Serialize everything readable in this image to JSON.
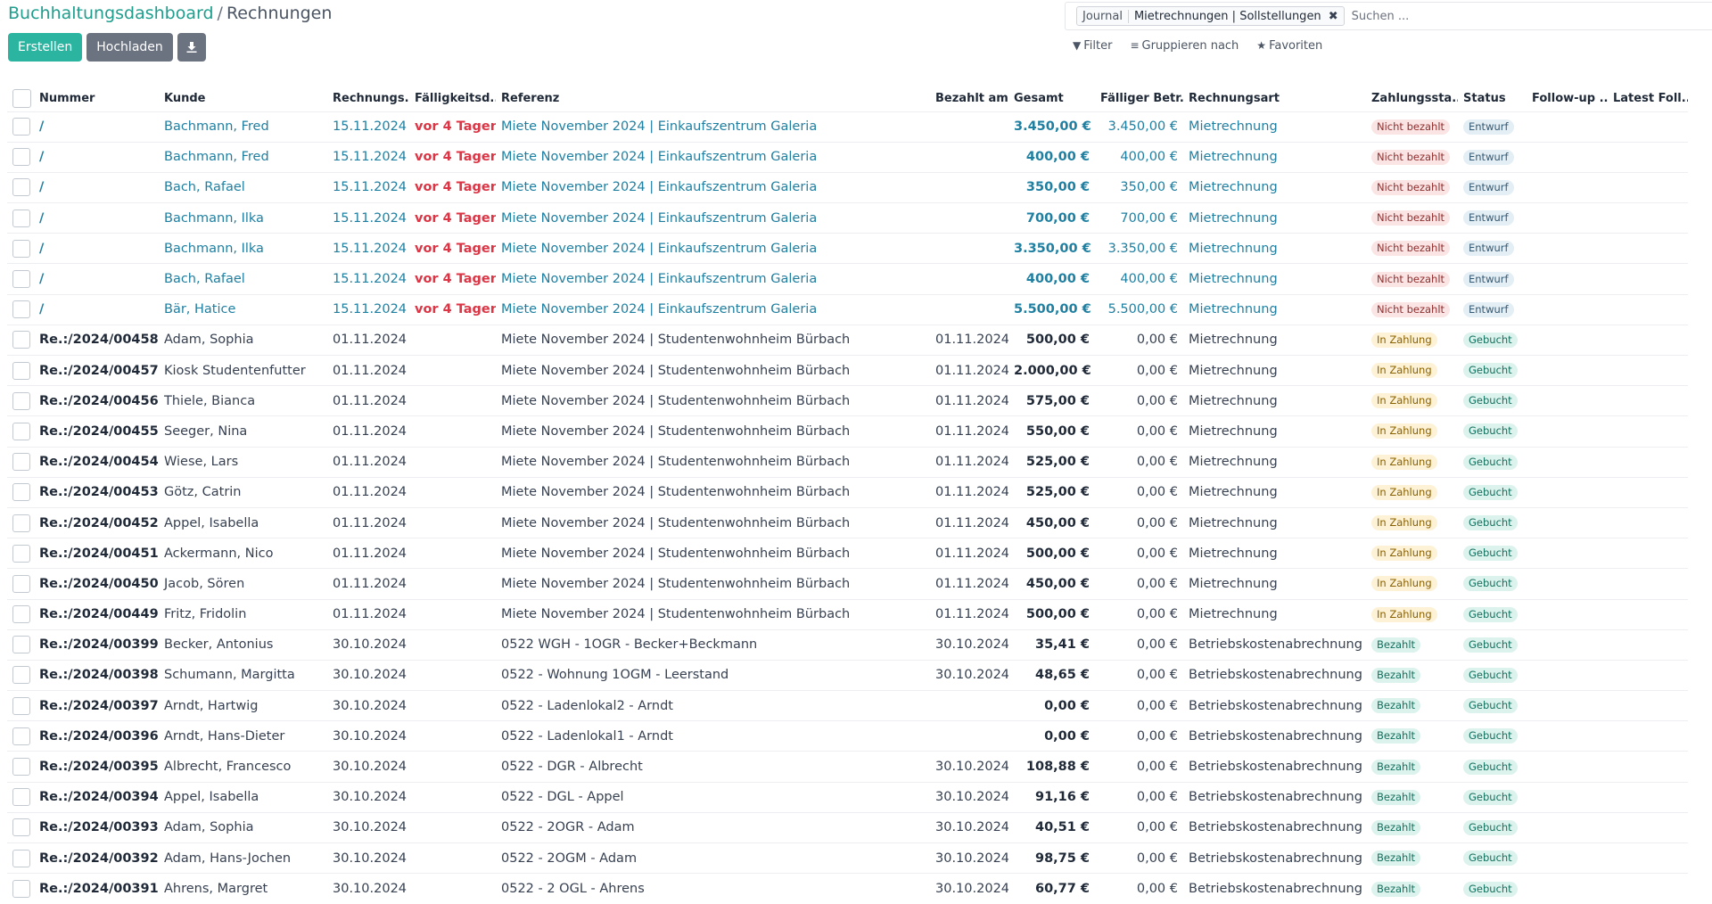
{
  "breadcrumb": {
    "parent": "Buchhaltungsdashboard",
    "separator": "/",
    "current": "Rechnungen"
  },
  "toolbar": {
    "create_label": "Erstellen",
    "upload_label": "Hochladen",
    "download_icon": "download-icon"
  },
  "search": {
    "facet_label": "Journal",
    "facet_value": "Mietrechnungen | Sollstellungen",
    "placeholder": "Suchen ..."
  },
  "filters": {
    "filter_label": "Filter",
    "group_label": "Gruppieren nach",
    "favorites_label": "Favoriten"
  },
  "colors": {
    "primary": "#2bb4a0",
    "link": "#1f7fa1",
    "danger": "#dc3545"
  },
  "columns": [
    "Nummer",
    "Kunde",
    "Rechnungs...",
    "Fälligkeitsd...",
    "Referenz",
    "Bezahlt am",
    "Gesamt",
    "Fälliger Betr...",
    "Rechnungsart",
    "Zahlungssta...",
    "Status",
    "Follow-up ...",
    "Latest Foll..."
  ],
  "rows": [
    {
      "number": "/",
      "customer": "Bachmann, Fred",
      "invoice_date": "15.11.2024",
      "due": "vor 4 Tagen",
      "reference": "Miete November 2024 | Einkaufszentrum Galeria",
      "paid_on": "",
      "total": "3.450,00 €",
      "due_amount": "3.450,00 €",
      "type": "Mietrechnung",
      "payment_status": "Nicht bezahlt",
      "status": "Entwurf",
      "draft": true
    },
    {
      "number": "/",
      "customer": "Bachmann, Fred",
      "invoice_date": "15.11.2024",
      "due": "vor 4 Tagen",
      "reference": "Miete November 2024 | Einkaufszentrum Galeria",
      "paid_on": "",
      "total": "400,00 €",
      "due_amount": "400,00 €",
      "type": "Mietrechnung",
      "payment_status": "Nicht bezahlt",
      "status": "Entwurf",
      "draft": true
    },
    {
      "number": "/",
      "customer": "Bach, Rafael",
      "invoice_date": "15.11.2024",
      "due": "vor 4 Tagen",
      "reference": "Miete November 2024 | Einkaufszentrum Galeria",
      "paid_on": "",
      "total": "350,00 €",
      "due_amount": "350,00 €",
      "type": "Mietrechnung",
      "payment_status": "Nicht bezahlt",
      "status": "Entwurf",
      "draft": true
    },
    {
      "number": "/",
      "customer": "Bachmann, Ilka",
      "invoice_date": "15.11.2024",
      "due": "vor 4 Tagen",
      "reference": "Miete November 2024 | Einkaufszentrum Galeria",
      "paid_on": "",
      "total": "700,00 €",
      "due_amount": "700,00 €",
      "type": "Mietrechnung",
      "payment_status": "Nicht bezahlt",
      "status": "Entwurf",
      "draft": true
    },
    {
      "number": "/",
      "customer": "Bachmann, Ilka",
      "invoice_date": "15.11.2024",
      "due": "vor 4 Tagen",
      "reference": "Miete November 2024 | Einkaufszentrum Galeria",
      "paid_on": "",
      "total": "3.350,00 €",
      "due_amount": "3.350,00 €",
      "type": "Mietrechnung",
      "payment_status": "Nicht bezahlt",
      "status": "Entwurf",
      "draft": true
    },
    {
      "number": "/",
      "customer": "Bach, Rafael",
      "invoice_date": "15.11.2024",
      "due": "vor 4 Tagen",
      "reference": "Miete November 2024 | Einkaufszentrum Galeria",
      "paid_on": "",
      "total": "400,00 €",
      "due_amount": "400,00 €",
      "type": "Mietrechnung",
      "payment_status": "Nicht bezahlt",
      "status": "Entwurf",
      "draft": true
    },
    {
      "number": "/",
      "customer": "Bär, Hatice",
      "invoice_date": "15.11.2024",
      "due": "vor 4 Tagen",
      "reference": "Miete November 2024 | Einkaufszentrum Galeria",
      "paid_on": "",
      "total": "5.500,00 €",
      "due_amount": "5.500,00 €",
      "type": "Mietrechnung",
      "payment_status": "Nicht bezahlt",
      "status": "Entwurf",
      "draft": true
    },
    {
      "number": "Re.:/2024/00458",
      "customer": "Adam, Sophia",
      "invoice_date": "01.11.2024",
      "due": "",
      "reference": "Miete November 2024 | Studentenwohnheim Bürbach",
      "paid_on": "01.11.2024",
      "total": "500,00 €",
      "due_amount": "0,00 €",
      "type": "Mietrechnung",
      "payment_status": "In Zahlung",
      "status": "Gebucht",
      "draft": false
    },
    {
      "number": "Re.:/2024/00457",
      "customer": "Kiosk Studentenfutter",
      "invoice_date": "01.11.2024",
      "due": "",
      "reference": "Miete November 2024 | Studentenwohnheim Bürbach",
      "paid_on": "01.11.2024",
      "total": "2.000,00 €",
      "due_amount": "0,00 €",
      "type": "Mietrechnung",
      "payment_status": "In Zahlung",
      "status": "Gebucht",
      "draft": false
    },
    {
      "number": "Re.:/2024/00456",
      "customer": "Thiele, Bianca",
      "invoice_date": "01.11.2024",
      "due": "",
      "reference": "Miete November 2024 | Studentenwohnheim Bürbach",
      "paid_on": "01.11.2024",
      "total": "575,00 €",
      "due_amount": "0,00 €",
      "type": "Mietrechnung",
      "payment_status": "In Zahlung",
      "status": "Gebucht",
      "draft": false
    },
    {
      "number": "Re.:/2024/00455",
      "customer": "Seeger, Nina",
      "invoice_date": "01.11.2024",
      "due": "",
      "reference": "Miete November 2024 | Studentenwohnheim Bürbach",
      "paid_on": "01.11.2024",
      "total": "550,00 €",
      "due_amount": "0,00 €",
      "type": "Mietrechnung",
      "payment_status": "In Zahlung",
      "status": "Gebucht",
      "draft": false
    },
    {
      "number": "Re.:/2024/00454",
      "customer": "Wiese, Lars",
      "invoice_date": "01.11.2024",
      "due": "",
      "reference": "Miete November 2024 | Studentenwohnheim Bürbach",
      "paid_on": "01.11.2024",
      "total": "525,00 €",
      "due_amount": "0,00 €",
      "type": "Mietrechnung",
      "payment_status": "In Zahlung",
      "status": "Gebucht",
      "draft": false
    },
    {
      "number": "Re.:/2024/00453",
      "customer": "Götz, Catrin",
      "invoice_date": "01.11.2024",
      "due": "",
      "reference": "Miete November 2024 | Studentenwohnheim Bürbach",
      "paid_on": "01.11.2024",
      "total": "525,00 €",
      "due_amount": "0,00 €",
      "type": "Mietrechnung",
      "payment_status": "In Zahlung",
      "status": "Gebucht",
      "draft": false
    },
    {
      "number": "Re.:/2024/00452",
      "customer": "Appel, Isabella",
      "invoice_date": "01.11.2024",
      "due": "",
      "reference": "Miete November 2024 | Studentenwohnheim Bürbach",
      "paid_on": "01.11.2024",
      "total": "450,00 €",
      "due_amount": "0,00 €",
      "type": "Mietrechnung",
      "payment_status": "In Zahlung",
      "status": "Gebucht",
      "draft": false
    },
    {
      "number": "Re.:/2024/00451",
      "customer": "Ackermann, Nico",
      "invoice_date": "01.11.2024",
      "due": "",
      "reference": "Miete November 2024 | Studentenwohnheim Bürbach",
      "paid_on": "01.11.2024",
      "total": "500,00 €",
      "due_amount": "0,00 €",
      "type": "Mietrechnung",
      "payment_status": "In Zahlung",
      "status": "Gebucht",
      "draft": false
    },
    {
      "number": "Re.:/2024/00450",
      "customer": "Jacob, Sören",
      "invoice_date": "01.11.2024",
      "due": "",
      "reference": "Miete November 2024 | Studentenwohnheim Bürbach",
      "paid_on": "01.11.2024",
      "total": "450,00 €",
      "due_amount": "0,00 €",
      "type": "Mietrechnung",
      "payment_status": "In Zahlung",
      "status": "Gebucht",
      "draft": false
    },
    {
      "number": "Re.:/2024/00449",
      "customer": "Fritz, Fridolin",
      "invoice_date": "01.11.2024",
      "due": "",
      "reference": "Miete November 2024 | Studentenwohnheim Bürbach",
      "paid_on": "01.11.2024",
      "total": "500,00 €",
      "due_amount": "0,00 €",
      "type": "Mietrechnung",
      "payment_status": "In Zahlung",
      "status": "Gebucht",
      "draft": false
    },
    {
      "number": "Re.:/2024/00399",
      "customer": "Becker, Antonius",
      "invoice_date": "30.10.2024",
      "due": "",
      "reference": "0522 WGH - 1OGR - Becker+Beckmann",
      "paid_on": "30.10.2024",
      "total": "35,41 €",
      "due_amount": "0,00 €",
      "type": "Betriebskostenabrechnung",
      "payment_status": "Bezahlt",
      "status": "Gebucht",
      "draft": false
    },
    {
      "number": "Re.:/2024/00398",
      "customer": "Schumann, Margitta",
      "invoice_date": "30.10.2024",
      "due": "",
      "reference": "0522 - Wohnung 1OGM - Leerstand",
      "paid_on": "30.10.2024",
      "total": "48,65 €",
      "due_amount": "0,00 €",
      "type": "Betriebskostenabrechnung",
      "payment_status": "Bezahlt",
      "status": "Gebucht",
      "draft": false
    },
    {
      "number": "Re.:/2024/00397",
      "customer": "Arndt, Hartwig",
      "invoice_date": "30.10.2024",
      "due": "",
      "reference": "0522 - Ladenlokal2 - Arndt",
      "paid_on": "",
      "total": "0,00 €",
      "due_amount": "0,00 €",
      "type": "Betriebskostenabrechnung",
      "payment_status": "Bezahlt",
      "status": "Gebucht",
      "draft": false
    },
    {
      "number": "Re.:/2024/00396",
      "customer": "Arndt, Hans-Dieter",
      "invoice_date": "30.10.2024",
      "due": "",
      "reference": "0522 - Ladenlokal1 - Arndt",
      "paid_on": "",
      "total": "0,00 €",
      "due_amount": "0,00 €",
      "type": "Betriebskostenabrechnung",
      "payment_status": "Bezahlt",
      "status": "Gebucht",
      "draft": false
    },
    {
      "number": "Re.:/2024/00395",
      "customer": "Albrecht, Francesco",
      "invoice_date": "30.10.2024",
      "due": "",
      "reference": "0522 - DGR - Albrecht",
      "paid_on": "30.10.2024",
      "total": "108,88 €",
      "due_amount": "0,00 €",
      "type": "Betriebskostenabrechnung",
      "payment_status": "Bezahlt",
      "status": "Gebucht",
      "draft": false
    },
    {
      "number": "Re.:/2024/00394",
      "customer": "Appel, Isabella",
      "invoice_date": "30.10.2024",
      "due": "",
      "reference": "0522 - DGL - Appel",
      "paid_on": "30.10.2024",
      "total": "91,16 €",
      "due_amount": "0,00 €",
      "type": "Betriebskostenabrechnung",
      "payment_status": "Bezahlt",
      "status": "Gebucht",
      "draft": false
    },
    {
      "number": "Re.:/2024/00393",
      "customer": "Adam, Sophia",
      "invoice_date": "30.10.2024",
      "due": "",
      "reference": "0522 - 2OGR - Adam",
      "paid_on": "30.10.2024",
      "total": "40,51 €",
      "due_amount": "0,00 €",
      "type": "Betriebskostenabrechnung",
      "payment_status": "Bezahlt",
      "status": "Gebucht",
      "draft": false
    },
    {
      "number": "Re.:/2024/00392",
      "customer": "Adam, Hans-Jochen",
      "invoice_date": "30.10.2024",
      "due": "",
      "reference": "0522 - 2OGM - Adam",
      "paid_on": "30.10.2024",
      "total": "98,75 €",
      "due_amount": "0,00 €",
      "type": "Betriebskostenabrechnung",
      "payment_status": "Bezahlt",
      "status": "Gebucht",
      "draft": false
    },
    {
      "number": "Re.:/2024/00391",
      "customer": "Ahrens, Margret",
      "invoice_date": "30.10.2024",
      "due": "",
      "reference": "0522 - 2 OGL - Ahrens",
      "paid_on": "30.10.2024",
      "total": "60,77 €",
      "due_amount": "0,00 €",
      "type": "Betriebskostenabrechnung",
      "payment_status": "Bezahlt",
      "status": "Gebucht",
      "draft": false
    }
  ]
}
